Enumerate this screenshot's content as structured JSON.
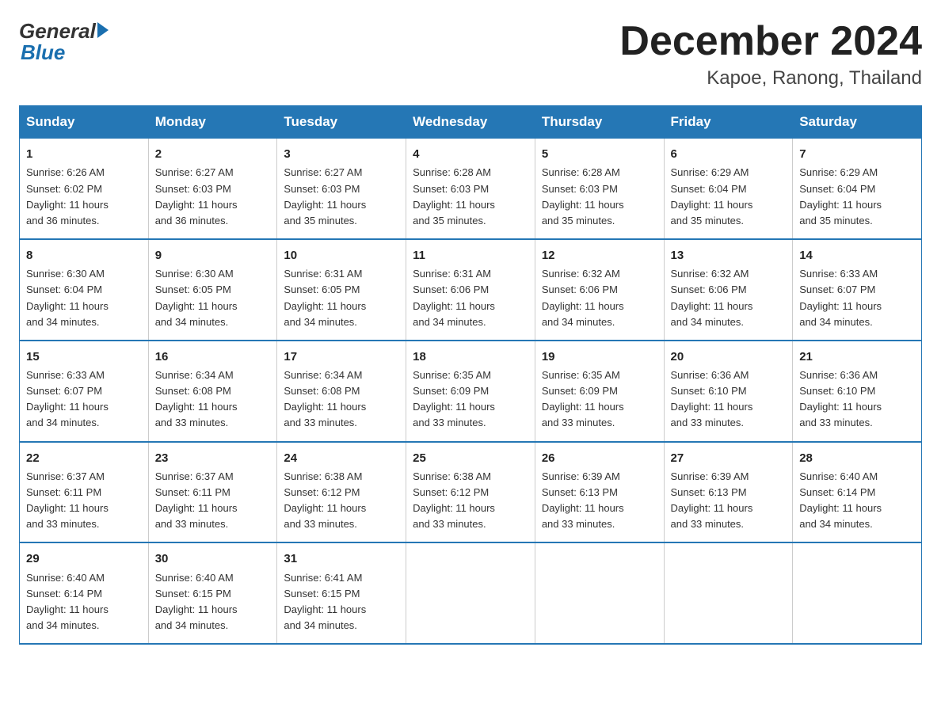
{
  "header": {
    "logo_general": "General",
    "logo_blue": "Blue",
    "month_title": "December 2024",
    "location": "Kapoe, Ranong, Thailand"
  },
  "columns": [
    "Sunday",
    "Monday",
    "Tuesday",
    "Wednesday",
    "Thursday",
    "Friday",
    "Saturday"
  ],
  "weeks": [
    [
      {
        "day": "1",
        "info": "Sunrise: 6:26 AM\nSunset: 6:02 PM\nDaylight: 11 hours\nand 36 minutes."
      },
      {
        "day": "2",
        "info": "Sunrise: 6:27 AM\nSunset: 6:03 PM\nDaylight: 11 hours\nand 36 minutes."
      },
      {
        "day": "3",
        "info": "Sunrise: 6:27 AM\nSunset: 6:03 PM\nDaylight: 11 hours\nand 35 minutes."
      },
      {
        "day": "4",
        "info": "Sunrise: 6:28 AM\nSunset: 6:03 PM\nDaylight: 11 hours\nand 35 minutes."
      },
      {
        "day": "5",
        "info": "Sunrise: 6:28 AM\nSunset: 6:03 PM\nDaylight: 11 hours\nand 35 minutes."
      },
      {
        "day": "6",
        "info": "Sunrise: 6:29 AM\nSunset: 6:04 PM\nDaylight: 11 hours\nand 35 minutes."
      },
      {
        "day": "7",
        "info": "Sunrise: 6:29 AM\nSunset: 6:04 PM\nDaylight: 11 hours\nand 35 minutes."
      }
    ],
    [
      {
        "day": "8",
        "info": "Sunrise: 6:30 AM\nSunset: 6:04 PM\nDaylight: 11 hours\nand 34 minutes."
      },
      {
        "day": "9",
        "info": "Sunrise: 6:30 AM\nSunset: 6:05 PM\nDaylight: 11 hours\nand 34 minutes."
      },
      {
        "day": "10",
        "info": "Sunrise: 6:31 AM\nSunset: 6:05 PM\nDaylight: 11 hours\nand 34 minutes."
      },
      {
        "day": "11",
        "info": "Sunrise: 6:31 AM\nSunset: 6:06 PM\nDaylight: 11 hours\nand 34 minutes."
      },
      {
        "day": "12",
        "info": "Sunrise: 6:32 AM\nSunset: 6:06 PM\nDaylight: 11 hours\nand 34 minutes."
      },
      {
        "day": "13",
        "info": "Sunrise: 6:32 AM\nSunset: 6:06 PM\nDaylight: 11 hours\nand 34 minutes."
      },
      {
        "day": "14",
        "info": "Sunrise: 6:33 AM\nSunset: 6:07 PM\nDaylight: 11 hours\nand 34 minutes."
      }
    ],
    [
      {
        "day": "15",
        "info": "Sunrise: 6:33 AM\nSunset: 6:07 PM\nDaylight: 11 hours\nand 34 minutes."
      },
      {
        "day": "16",
        "info": "Sunrise: 6:34 AM\nSunset: 6:08 PM\nDaylight: 11 hours\nand 33 minutes."
      },
      {
        "day": "17",
        "info": "Sunrise: 6:34 AM\nSunset: 6:08 PM\nDaylight: 11 hours\nand 33 minutes."
      },
      {
        "day": "18",
        "info": "Sunrise: 6:35 AM\nSunset: 6:09 PM\nDaylight: 11 hours\nand 33 minutes."
      },
      {
        "day": "19",
        "info": "Sunrise: 6:35 AM\nSunset: 6:09 PM\nDaylight: 11 hours\nand 33 minutes."
      },
      {
        "day": "20",
        "info": "Sunrise: 6:36 AM\nSunset: 6:10 PM\nDaylight: 11 hours\nand 33 minutes."
      },
      {
        "day": "21",
        "info": "Sunrise: 6:36 AM\nSunset: 6:10 PM\nDaylight: 11 hours\nand 33 minutes."
      }
    ],
    [
      {
        "day": "22",
        "info": "Sunrise: 6:37 AM\nSunset: 6:11 PM\nDaylight: 11 hours\nand 33 minutes."
      },
      {
        "day": "23",
        "info": "Sunrise: 6:37 AM\nSunset: 6:11 PM\nDaylight: 11 hours\nand 33 minutes."
      },
      {
        "day": "24",
        "info": "Sunrise: 6:38 AM\nSunset: 6:12 PM\nDaylight: 11 hours\nand 33 minutes."
      },
      {
        "day": "25",
        "info": "Sunrise: 6:38 AM\nSunset: 6:12 PM\nDaylight: 11 hours\nand 33 minutes."
      },
      {
        "day": "26",
        "info": "Sunrise: 6:39 AM\nSunset: 6:13 PM\nDaylight: 11 hours\nand 33 minutes."
      },
      {
        "day": "27",
        "info": "Sunrise: 6:39 AM\nSunset: 6:13 PM\nDaylight: 11 hours\nand 33 minutes."
      },
      {
        "day": "28",
        "info": "Sunrise: 6:40 AM\nSunset: 6:14 PM\nDaylight: 11 hours\nand 34 minutes."
      }
    ],
    [
      {
        "day": "29",
        "info": "Sunrise: 6:40 AM\nSunset: 6:14 PM\nDaylight: 11 hours\nand 34 minutes."
      },
      {
        "day": "30",
        "info": "Sunrise: 6:40 AM\nSunset: 6:15 PM\nDaylight: 11 hours\nand 34 minutes."
      },
      {
        "day": "31",
        "info": "Sunrise: 6:41 AM\nSunset: 6:15 PM\nDaylight: 11 hours\nand 34 minutes."
      },
      {
        "day": "",
        "info": ""
      },
      {
        "day": "",
        "info": ""
      },
      {
        "day": "",
        "info": ""
      },
      {
        "day": "",
        "info": ""
      }
    ]
  ]
}
